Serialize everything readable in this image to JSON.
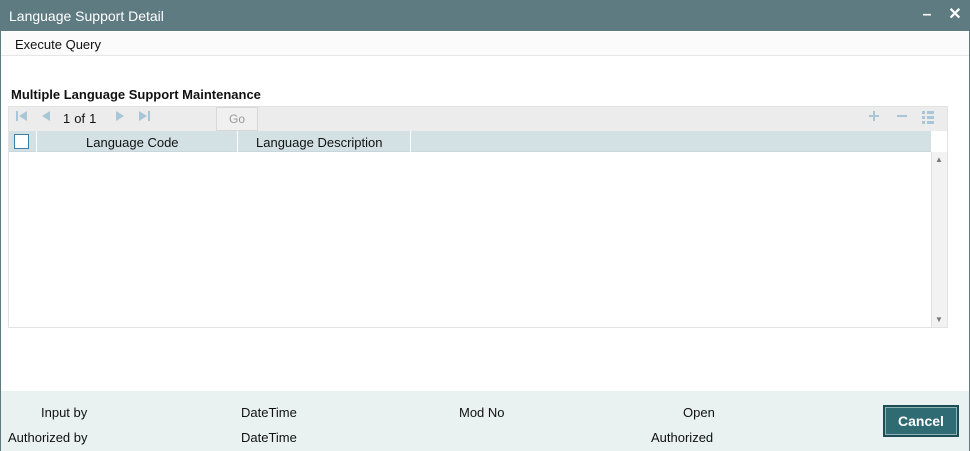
{
  "window": {
    "title": "Language Support Detail",
    "minimize_label": "–",
    "close_label": "✕"
  },
  "menu": {
    "execute_query": "Execute Query"
  },
  "section": {
    "title": "Multiple Language Support Maintenance"
  },
  "pager": {
    "current_page": "1",
    "of_label": "of",
    "total_pages": "1",
    "go_label": "Go"
  },
  "grid": {
    "columns": [
      "Language Code",
      "Language Description"
    ],
    "rows": []
  },
  "footer": {
    "input_by": "Input by",
    "authorized_by": "Authorized by",
    "datetime_1": "DateTime",
    "datetime_2": "DateTime",
    "mod_no": "Mod No",
    "open": "Open",
    "authorized": "Authorized",
    "cancel_label": "Cancel"
  },
  "icons": {
    "first": "first-page-icon",
    "prev": "previous-page-icon",
    "next": "next-page-icon",
    "last": "last-page-icon",
    "add": "add-row-icon",
    "remove": "delete-row-icon",
    "list": "single-view-icon"
  },
  "colors": {
    "titlebar": "#5f7b82",
    "header_row": "#d4e1e4",
    "footer": "#e9f2f1",
    "cancel_button": "#2e6b73",
    "nav_icon": "#a8c6d6"
  }
}
